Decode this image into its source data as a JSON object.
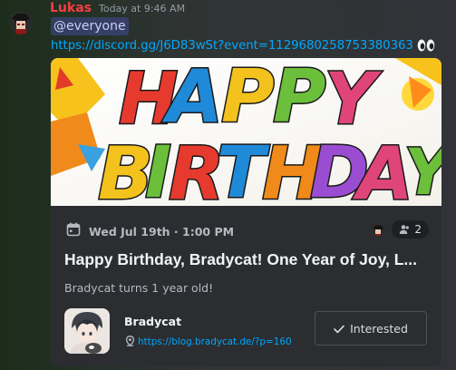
{
  "message": {
    "author": "Lukas",
    "timestamp": "Today at 9:46 AM",
    "mention": "@everyone",
    "invite_link": "https://discord.gg/J6D83wSt?event=1129680258753380363",
    "emoji": "eyes"
  },
  "event": {
    "banner_text": "HAPPY BIRTHDAY",
    "date": "Wed Jul 19th · 1:00 PM",
    "interested_count": "2",
    "title": "Happy Birthday, Bradycat! One Year of Joy, L...",
    "description": "Bradycat turns 1 year old!",
    "host_name": "Bradycat",
    "location_url": "https://blog.bradycat.de/?p=160",
    "interested_label": "Interested"
  },
  "colors": {
    "username": "#f23f42",
    "link": "#00a8fc",
    "card_bg": "#2b2d31",
    "mention_bg": "rgba(88,101,242,0.3)"
  }
}
